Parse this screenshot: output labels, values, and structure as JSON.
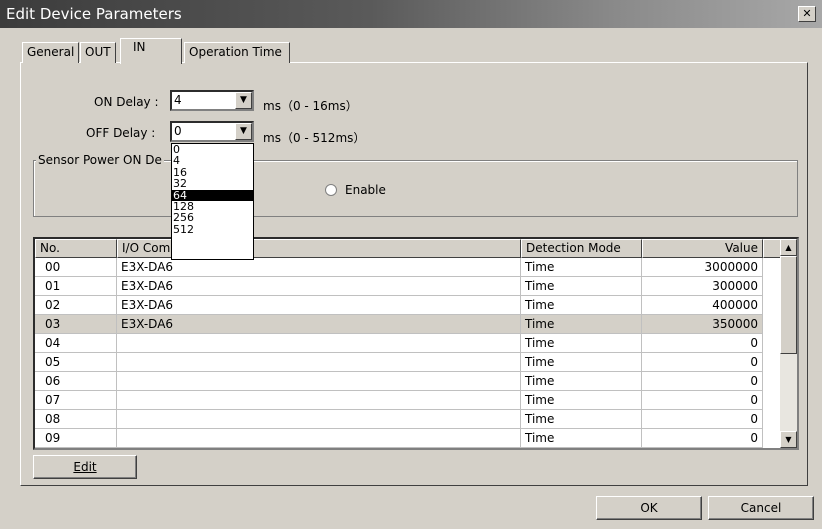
{
  "window": {
    "title": "Edit Device Parameters"
  },
  "tabs": [
    "General",
    "OUT",
    "IN",
    "Operation Time"
  ],
  "on_delay": {
    "label": "ON Delay :",
    "value": "4",
    "range": "ms（0 - 16ms）"
  },
  "off_delay": {
    "label": "OFF Delay :",
    "value": "0",
    "range": "ms（0 - 512ms）",
    "options": [
      "0",
      "4",
      "16",
      "32",
      "64",
      "128",
      "256",
      "512"
    ],
    "highlighted": "64"
  },
  "sensor_power": {
    "caption": "Sensor Power ON De",
    "enable_label": "Enable"
  },
  "table": {
    "headers": [
      "No.",
      "I/O Com",
      "Detection Mode",
      "Value"
    ],
    "rows": [
      {
        "no": "00",
        "io": "E3X-DA6",
        "mode": "Time",
        "value": "3000000"
      },
      {
        "no": "01",
        "io": "E3X-DA6",
        "mode": "Time",
        "value": "300000"
      },
      {
        "no": "02",
        "io": "E3X-DA6",
        "mode": "Time",
        "value": "400000"
      },
      {
        "no": "03",
        "io": "E3X-DA6",
        "mode": "Time",
        "value": "350000"
      },
      {
        "no": "04",
        "io": "",
        "mode": "Time",
        "value": "0"
      },
      {
        "no": "05",
        "io": "",
        "mode": "Time",
        "value": "0"
      },
      {
        "no": "06",
        "io": "",
        "mode": "Time",
        "value": "0"
      },
      {
        "no": "07",
        "io": "",
        "mode": "Time",
        "value": "0"
      },
      {
        "no": "08",
        "io": "",
        "mode": "Time",
        "value": "0"
      },
      {
        "no": "09",
        "io": "",
        "mode": "Time",
        "value": "0"
      }
    ],
    "highlighted_row": "03"
  },
  "buttons": {
    "edit": "Edit",
    "ok": "OK",
    "cancel": "Cancel"
  },
  "icons": {
    "close": "close-icon",
    "dropdown": "chevron-down-icon",
    "scroll_up": "scroll-up-icon",
    "scroll_down": "scroll-down-icon"
  },
  "colors": {
    "face": "#d4d0c8",
    "title_dark": "#3c3c3c",
    "selection": "#000000"
  }
}
